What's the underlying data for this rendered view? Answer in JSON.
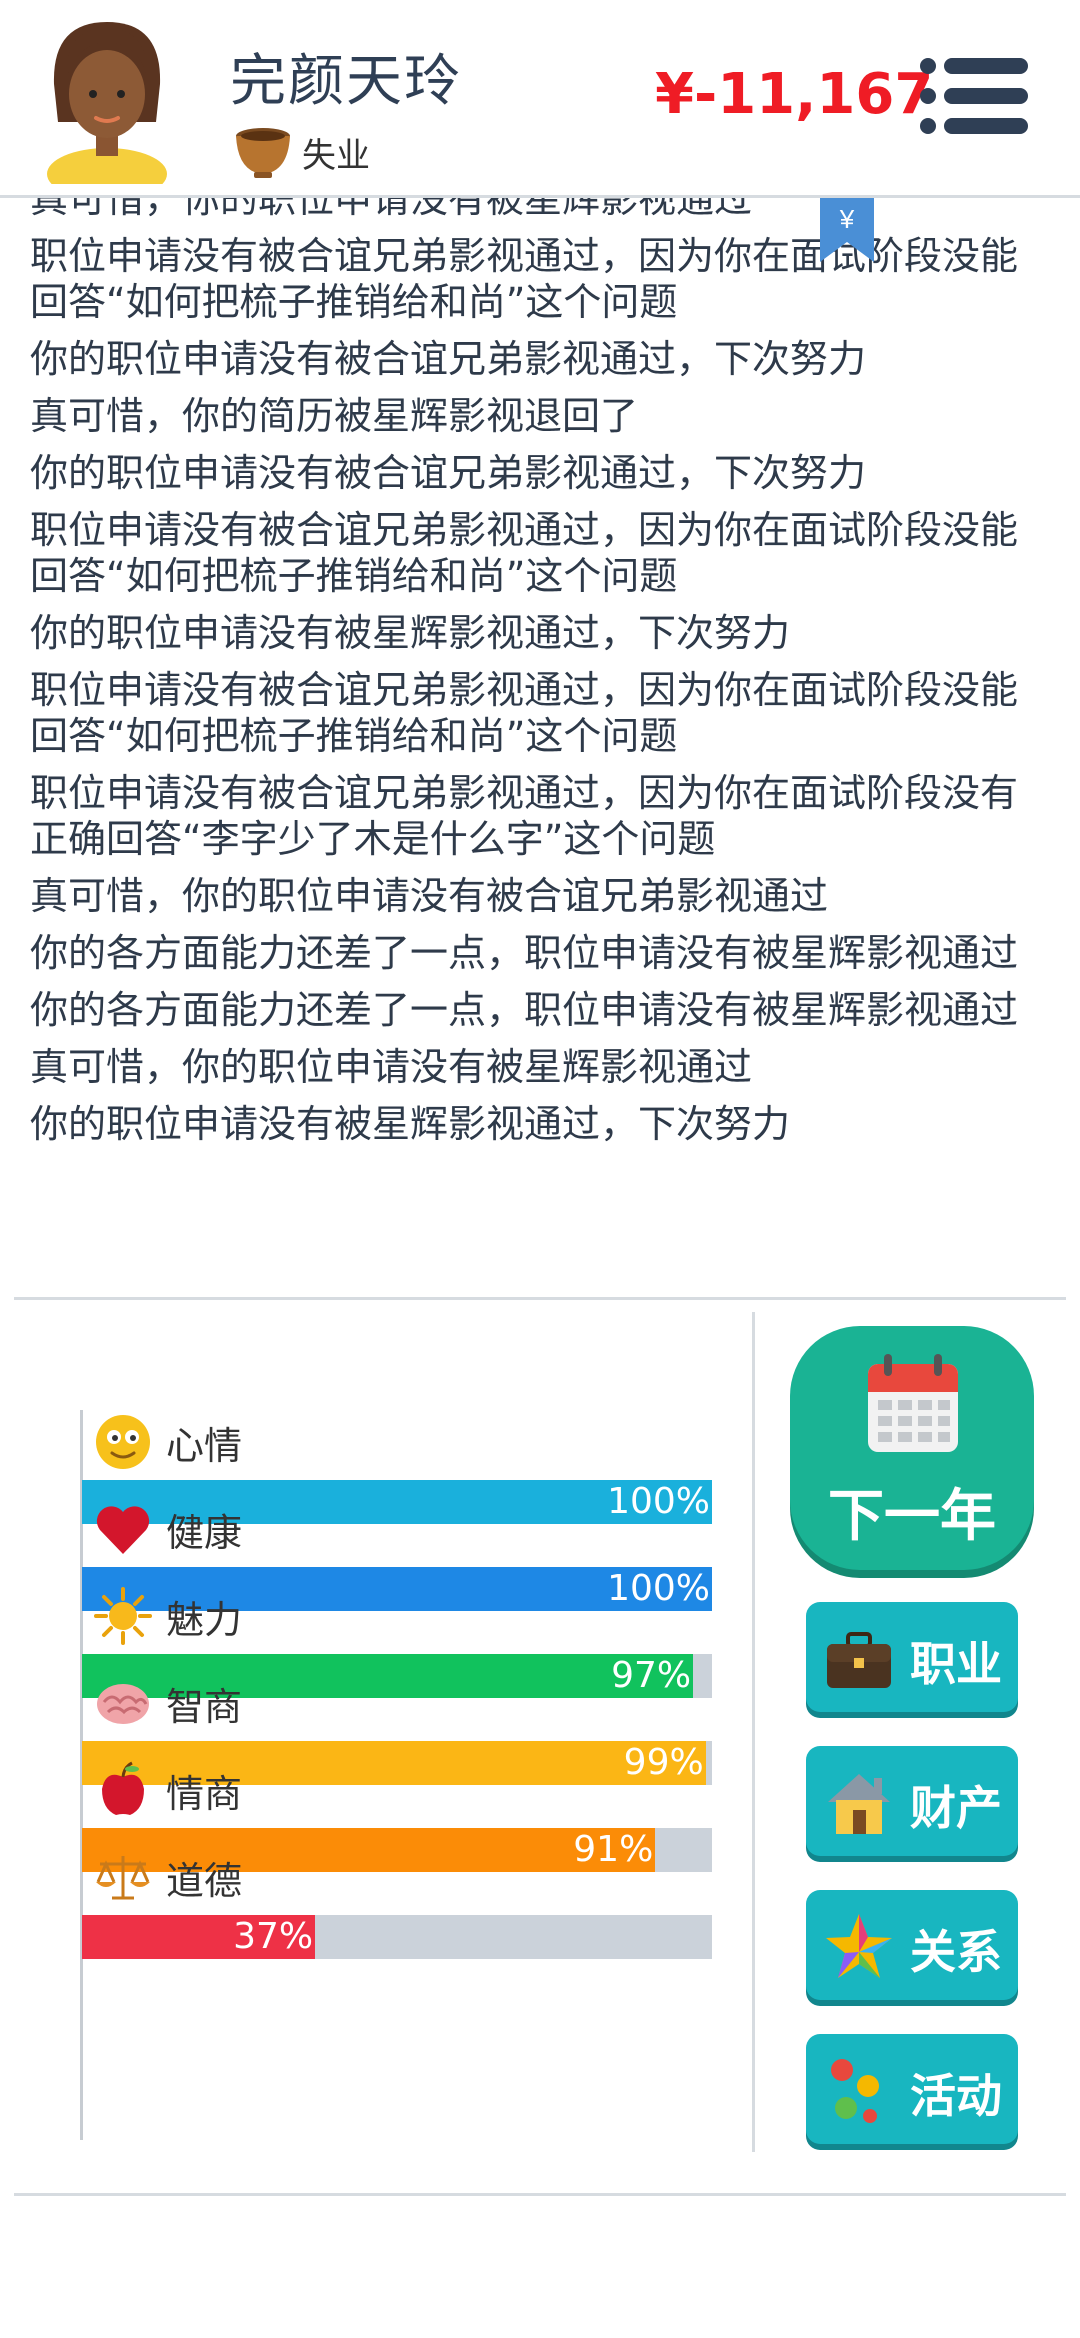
{
  "header": {
    "name": "完颜天玲",
    "status": "失业",
    "money": "¥-11,167"
  },
  "log": {
    "yen_tag": "¥",
    "entries": [
      "真可惜，你的职位申请没有被星辉影视通过",
      "职位申请没有被合谊兄弟影视通过，因为你在面试阶段没能回答“如何把梳子推销给和尚”这个问题",
      "你的职位申请没有被合谊兄弟影视通过，下次努力",
      "真可惜，你的简历被星辉影视退回了",
      "你的职位申请没有被合谊兄弟影视通过，下次努力",
      "职位申请没有被合谊兄弟影视通过，因为你在面试阶段没能回答“如何把梳子推销给和尚”这个问题",
      "你的职位申请没有被星辉影视通过，下次努力",
      "职位申请没有被合谊兄弟影视通过，因为你在面试阶段没能回答“如何把梳子推销给和尚”这个问题",
      "职位申请没有被合谊兄弟影视通过，因为你在面试阶段没有正确回答“李字少了木是什么字”这个问题",
      "真可惜，你的职位申请没有被合谊兄弟影视通过",
      "你的各方面能力还差了一点，职位申请没有被星辉影视通过",
      "你的各方面能力还差了一点，职位申请没有被星辉影视通过",
      "真可惜，你的职位申请没有被星辉影视通过",
      "你的职位申请没有被星辉影视通过，下次努力"
    ]
  },
  "stats": [
    {
      "key": "mood",
      "name": "心情",
      "value_text": "100%",
      "fraction": 1.0,
      "color": "#1ab0dc",
      "icon": "smiley-icon"
    },
    {
      "key": "health",
      "name": "健康",
      "value_text": "100%",
      "fraction": 1.0,
      "color": "#1e88e5",
      "icon": "heart-icon"
    },
    {
      "key": "charm",
      "name": "魅力",
      "value_text": "97%",
      "fraction": 0.97,
      "color": "#11c25d",
      "icon": "sun-icon"
    },
    {
      "key": "iq",
      "name": "智商",
      "value_text": "99%",
      "fraction": 0.99,
      "color": "#fbb615",
      "icon": "brain-icon"
    },
    {
      "key": "eq",
      "name": "情商",
      "value_text": "91%",
      "fraction": 0.91,
      "color": "#fb8c07",
      "icon": "apple-icon"
    },
    {
      "key": "morality",
      "name": "道德",
      "value_text": "37%",
      "fraction": 0.37,
      "color": "#ee3146",
      "icon": "scales-icon"
    }
  ],
  "actions": {
    "next_year": "下一年",
    "career": "职业",
    "property": "财产",
    "relations": "关系",
    "activities": "活动"
  },
  "colors": {
    "money": "#ef1c25",
    "next_year_button": "#1ab394",
    "action_button": "#18b6c0"
  }
}
